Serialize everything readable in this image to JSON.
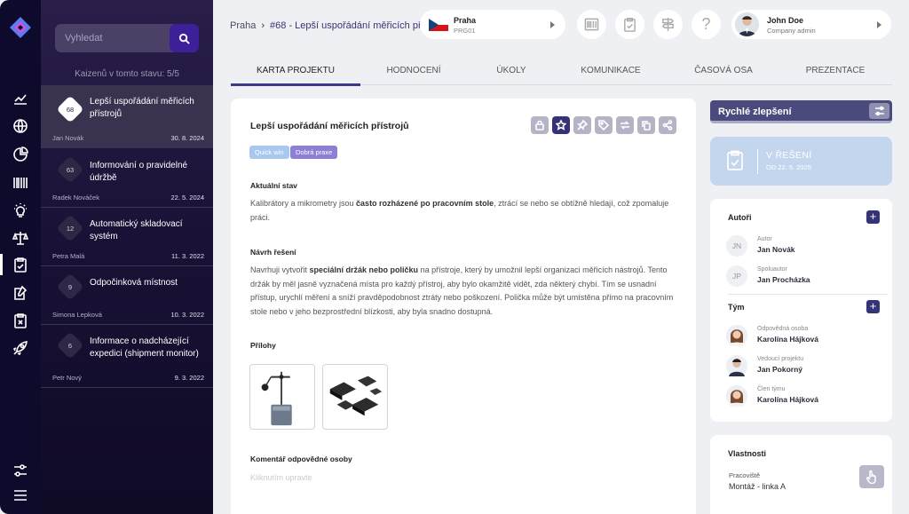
{
  "nav": {
    "icons": [
      "logo-icon",
      "chart-icon",
      "globe-icon",
      "pie-chart-icon",
      "barcode-icon",
      "bulb-icon",
      "scales-icon",
      "clipboard-check-icon",
      "edit-document-icon",
      "clipboard-x-icon",
      "rocket-icon",
      "settings-sliders-icon",
      "menu-icon"
    ],
    "active": "clipboard-check-icon"
  },
  "list": {
    "search_placeholder": "Vyhledat",
    "count_text": "Kaizenů v tomto stavu: 5/5",
    "items": [
      {
        "number": "68",
        "title": "Lepší uspořádání měřicích přístrojů",
        "author": "Jan Novák",
        "date": "30. 8. 2024",
        "active": true
      },
      {
        "number": "63",
        "title": "Informování o pravidelné údržbě",
        "author": "Radek Nováček",
        "date": "22. 5. 2024"
      },
      {
        "number": "12",
        "title": "Automatický skladovací systém",
        "author": "Petra Malá",
        "date": "11. 3. 2022"
      },
      {
        "number": "9",
        "title": "Odpočinková místnost",
        "author": "Simona Lepková",
        "date": "10. 3. 2022"
      },
      {
        "number": "6",
        "title": "Informace o nadcházející expedici (shipment monitor)",
        "author": "Petr Nový",
        "date": "9. 3. 2022"
      }
    ]
  },
  "header": {
    "breadcrumb_root": "Praha",
    "breadcrumb_sep": "›",
    "breadcrumb_current": "#68 - Lepší uspořádání měřicích př...",
    "location": {
      "name": "Praha",
      "code": "PRG01"
    },
    "user": {
      "name": "John Doe",
      "role": "Company admin"
    },
    "help_glyph": "?"
  },
  "tabs": [
    "KARTA PROJEKTU",
    "HODNOCENÍ",
    "ÚKOLY",
    "KOMUNIKACE",
    "ČASOVÁ OSA",
    "PREZENTACE"
  ],
  "main": {
    "title": "Lepší uspořádání měřicích přístrojů",
    "tags": [
      {
        "label": "Quick win",
        "color": "#a9c8f0"
      },
      {
        "label": "Dobrá praxe",
        "color": "#8e7fd6"
      }
    ],
    "current_state_heading": "Aktuální stav",
    "current_state": {
      "before": "Kalibrátory a mikrometry jsou ",
      "bold": "často rozházené po pracovním stole",
      "after": ", ztrácí se nebo se obtížně hledají, což zpomaluje práci."
    },
    "solution_heading": "Návrh řešení",
    "solution": {
      "before": "Navrhuji vytvořit ",
      "bold": "speciální držák nebo poličku",
      "after": " na přístroje, který by umožnil lepší organizaci měřicích nástrojů. Tento držák by měl jasně vyznačená místa pro každý přístroj, aby bylo okamžitě vidět, zda některý chybí. Tím se usnadní přístup, urychlí měření a sníží pravděpodobnost ztráty nebo poškození. Polička může být umístěna přímo na pracovním stole nebo v jeho bezprostřední blízkosti, aby byla snadno dostupná."
    },
    "attachments_heading": "Přílohy",
    "comment_heading": "Komentář odpovědné osoby",
    "comment_placeholder": "Kliknutím upravte"
  },
  "right": {
    "quick_label": "Rychlé zlepšení",
    "status_title": "V ŘEŠENÍ",
    "status_since": "OD 22. 5. 2025",
    "authors_heading": "Autoři",
    "authors": [
      {
        "initials": "JN",
        "role": "Autor",
        "name": "Jan Novák"
      },
      {
        "initials": "JP",
        "role": "Spoluautor",
        "name": "Jan Procházka"
      }
    ],
    "team_heading": "Tým",
    "team": [
      {
        "role": "Odpovědná osoba",
        "name": "Karolína Hájková"
      },
      {
        "role": "Vedoucí projektu",
        "name": "Jan Pokorný"
      },
      {
        "role": "Člen týmu",
        "name": "Karolína Hájková"
      }
    ],
    "props_heading": "Vlastnosti",
    "workplace_label": "Pracoviště",
    "workplace_value": "Montáž - linka A"
  }
}
